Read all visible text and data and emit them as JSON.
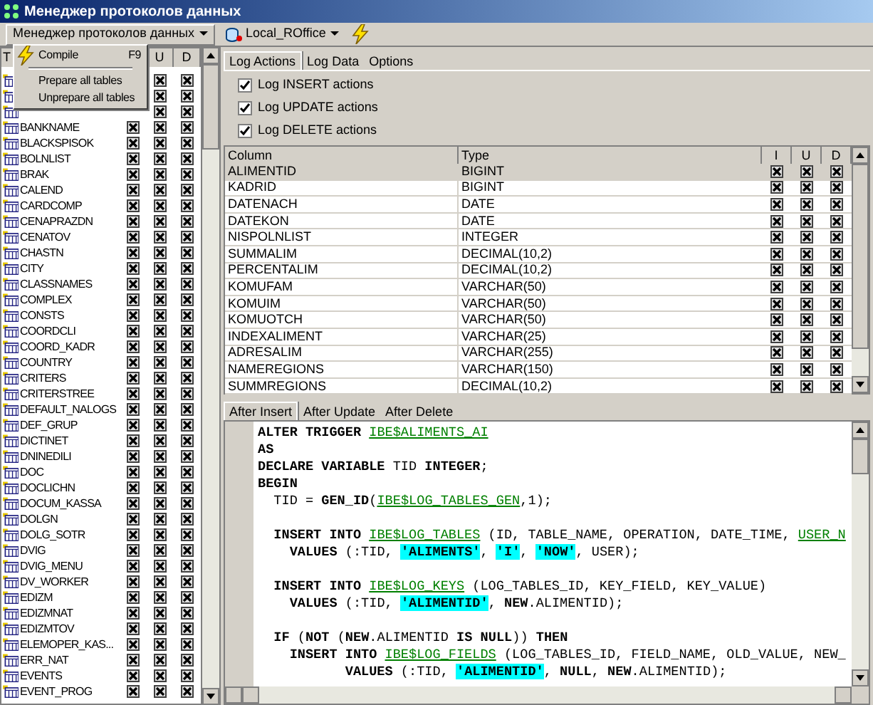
{
  "window": {
    "title": "Менеджер протоколов данных"
  },
  "toolbar": {
    "manager_button": "Менеджер протоколов данных",
    "database_button": "Local_ROffice"
  },
  "menu": {
    "items": [
      {
        "kind": "command",
        "label": "Compile",
        "shortcut": "F9"
      },
      {
        "kind": "separator"
      },
      {
        "kind": "command",
        "label": "Prepare all tables"
      },
      {
        "kind": "command",
        "label": "Unprepare all tables"
      }
    ]
  },
  "tables": {
    "columns": [
      "T",
      "U",
      "D"
    ],
    "rows": [
      {
        "u": true,
        "d": true
      },
      {
        "u": true,
        "d": true
      },
      {
        "u": true,
        "d": true
      },
      {
        "name": "BANKNAME",
        "i": true,
        "u": true,
        "d": true
      },
      {
        "name": "BLACKSPISOK",
        "i": true,
        "u": true,
        "d": true
      },
      {
        "name": "BOLNLIST",
        "i": true,
        "u": true,
        "d": true
      },
      {
        "name": "BRAK",
        "i": true,
        "u": true,
        "d": true
      },
      {
        "name": "CALEND",
        "i": true,
        "u": true,
        "d": true
      },
      {
        "name": "CARDCOMP",
        "i": true,
        "u": true,
        "d": true
      },
      {
        "name": "CENAPRAZDN",
        "i": true,
        "u": true,
        "d": true
      },
      {
        "name": "CENATOV",
        "i": true,
        "u": true,
        "d": true
      },
      {
        "name": "CHASTN",
        "i": true,
        "u": true,
        "d": true
      },
      {
        "name": "CITY",
        "i": true,
        "u": true,
        "d": true
      },
      {
        "name": "CLASSNAMES",
        "i": true,
        "u": true,
        "d": true
      },
      {
        "name": "COMPLEX",
        "i": true,
        "u": true,
        "d": true
      },
      {
        "name": "CONSTS",
        "i": true,
        "u": true,
        "d": true
      },
      {
        "name": "COORDCLI",
        "i": true,
        "u": true,
        "d": true
      },
      {
        "name": "COORD_KADR",
        "i": true,
        "u": true,
        "d": true
      },
      {
        "name": "COUNTRY",
        "i": true,
        "u": true,
        "d": true
      },
      {
        "name": "CRITERS",
        "i": true,
        "u": true,
        "d": true
      },
      {
        "name": "CRITERSTREE",
        "i": true,
        "u": true,
        "d": true
      },
      {
        "name": "DEFAULT_NALOGS",
        "i": true,
        "u": true,
        "d": true
      },
      {
        "name": "DEF_GRUP",
        "i": true,
        "u": true,
        "d": true
      },
      {
        "name": "DICTINET",
        "i": true,
        "u": true,
        "d": true
      },
      {
        "name": "DNINEDILI",
        "i": true,
        "u": true,
        "d": true
      },
      {
        "name": "DOC",
        "i": true,
        "u": true,
        "d": true
      },
      {
        "name": "DOCLICHN",
        "i": true,
        "u": true,
        "d": true
      },
      {
        "name": "DOCUM_KASSA",
        "i": true,
        "u": true,
        "d": true
      },
      {
        "name": "DOLGN",
        "i": true,
        "u": true,
        "d": true
      },
      {
        "name": "DOLG_SOTR",
        "i": true,
        "u": true,
        "d": true
      },
      {
        "name": "DVIG",
        "i": true,
        "u": true,
        "d": true
      },
      {
        "name": "DVIG_MENU",
        "i": true,
        "u": true,
        "d": true
      },
      {
        "name": "DV_WORKER",
        "i": true,
        "u": true,
        "d": true
      },
      {
        "name": "EDIZM",
        "i": true,
        "u": true,
        "d": true
      },
      {
        "name": "EDIZMNAT",
        "i": true,
        "u": true,
        "d": true
      },
      {
        "name": "EDIZMTOV",
        "i": true,
        "u": true,
        "d": true
      },
      {
        "name": "ELEMOPER_KAS...",
        "i": true,
        "u": true,
        "d": true
      },
      {
        "name": "ERR_NAT",
        "i": true,
        "u": true,
        "d": true
      },
      {
        "name": "EVENTS",
        "i": true,
        "u": true,
        "d": true
      },
      {
        "name": "EVENT_PROG",
        "i": true,
        "u": true,
        "d": true
      }
    ]
  },
  "tabs": [
    {
      "label": "Log Actions",
      "selected": true
    },
    {
      "label": "Log Data",
      "selected": false
    },
    {
      "label": "Options",
      "selected": false
    }
  ],
  "options": [
    {
      "label": "Log INSERT actions",
      "checked": true
    },
    {
      "label": "Log UPDATE actions",
      "checked": true
    },
    {
      "label": "Log DELETE actions",
      "checked": true
    }
  ],
  "fields": {
    "columns": [
      "Column",
      "Type",
      "I",
      "U",
      "D"
    ],
    "rows": [
      {
        "column": "ALIMENTID",
        "type": "BIGINT",
        "i": true,
        "u": true,
        "d": true,
        "selected": true
      },
      {
        "column": "KADRID",
        "type": "BIGINT",
        "i": true,
        "u": true,
        "d": true,
        "selected": false
      },
      {
        "column": "DATENACH",
        "type": "DATE",
        "i": true,
        "u": true,
        "d": true,
        "selected": false
      },
      {
        "column": "DATEKON",
        "type": "DATE",
        "i": true,
        "u": true,
        "d": true,
        "selected": false
      },
      {
        "column": "NISPOLNLIST",
        "type": "INTEGER",
        "i": true,
        "u": true,
        "d": true,
        "selected": false
      },
      {
        "column": "SUMMALIM",
        "type": "DECIMAL(10,2)",
        "i": true,
        "u": true,
        "d": true,
        "selected": false
      },
      {
        "column": "PERCENTALIM",
        "type": "DECIMAL(10,2)",
        "i": true,
        "u": true,
        "d": true,
        "selected": false
      },
      {
        "column": "KOMUFAM",
        "type": "VARCHAR(50)",
        "i": true,
        "u": true,
        "d": true,
        "selected": false
      },
      {
        "column": "KOMUIM",
        "type": "VARCHAR(50)",
        "i": true,
        "u": true,
        "d": true,
        "selected": false
      },
      {
        "column": "KOMUOTCH",
        "type": "VARCHAR(50)",
        "i": true,
        "u": true,
        "d": true,
        "selected": false
      },
      {
        "column": "INDEXALIMENT",
        "type": "VARCHAR(25)",
        "i": true,
        "u": true,
        "d": true,
        "selected": false
      },
      {
        "column": "ADRESALIM",
        "type": "VARCHAR(255)",
        "i": true,
        "u": true,
        "d": true,
        "selected": false
      },
      {
        "column": "NAMEREGIONS",
        "type": "VARCHAR(150)",
        "i": true,
        "u": true,
        "d": true,
        "selected": false
      },
      {
        "column": "SUMMREGIONS",
        "type": "DECIMAL(10,2)",
        "i": true,
        "u": true,
        "d": true,
        "selected": false
      }
    ]
  },
  "trigger_tabs": [
    {
      "label": "After Insert",
      "selected": true
    },
    {
      "label": "After Update",
      "selected": false
    },
    {
      "label": "After Delete",
      "selected": false
    }
  ],
  "code": [
    {
      "kind": "code",
      "segments": [
        {
          "kind": "kw",
          "text": "ALTER TRIGGER "
        },
        {
          "kind": "id",
          "text": "IBE$ALIMENTS_AI"
        }
      ]
    },
    {
      "kind": "code",
      "segments": [
        {
          "kind": "kw",
          "text": "AS"
        }
      ]
    },
    {
      "kind": "code",
      "segments": [
        {
          "kind": "kw",
          "text": "DECLARE VARIABLE"
        },
        {
          "kind": "plain",
          "text": " TID "
        },
        {
          "kind": "kw",
          "text": "INTEGER"
        },
        {
          "kind": "plain",
          "text": ";"
        }
      ]
    },
    {
      "kind": "code",
      "segments": [
        {
          "kind": "kw",
          "text": "BEGIN"
        }
      ]
    },
    {
      "kind": "code",
      "segments": [
        {
          "kind": "plain",
          "text": "  TID = "
        },
        {
          "kind": "kw",
          "text": "GEN_ID"
        },
        {
          "kind": "plain",
          "text": "("
        },
        {
          "kind": "id",
          "text": "IBE$LOG_TABLES_GEN"
        },
        {
          "kind": "plain",
          "text": ",1);"
        }
      ]
    },
    {
      "kind": "blank"
    },
    {
      "kind": "code",
      "segments": [
        {
          "kind": "kw",
          "text": "  INSERT INTO "
        },
        {
          "kind": "id",
          "text": "IBE$LOG_TABLES"
        },
        {
          "kind": "plain",
          "text": " (ID, TABLE_NAME, OPERATION, DATE_TIME, "
        },
        {
          "kind": "id",
          "text": "USER_N"
        }
      ]
    },
    {
      "kind": "code",
      "segments": [
        {
          "kind": "kw",
          "text": "    VALUES"
        },
        {
          "kind": "plain",
          "text": " (:TID, "
        },
        {
          "kind": "str",
          "text": "'ALIMENTS'"
        },
        {
          "kind": "plain",
          "text": ", "
        },
        {
          "kind": "str",
          "text": "'I'"
        },
        {
          "kind": "plain",
          "text": ", "
        },
        {
          "kind": "str",
          "text": "'NOW'"
        },
        {
          "kind": "plain",
          "text": ", USER);"
        }
      ]
    },
    {
      "kind": "blank"
    },
    {
      "kind": "code",
      "segments": [
        {
          "kind": "kw",
          "text": "  INSERT INTO "
        },
        {
          "kind": "id",
          "text": "IBE$LOG_KEYS"
        },
        {
          "kind": "plain",
          "text": " (LOG_TABLES_ID, KEY_FIELD, KEY_VALUE)"
        }
      ]
    },
    {
      "kind": "code",
      "segments": [
        {
          "kind": "kw",
          "text": "    VALUES"
        },
        {
          "kind": "plain",
          "text": " (:TID, "
        },
        {
          "kind": "str",
          "text": "'ALIMENTID'"
        },
        {
          "kind": "plain",
          "text": ", "
        },
        {
          "kind": "kw",
          "text": "NEW"
        },
        {
          "kind": "plain",
          "text": ".ALIMENTID);"
        }
      ]
    },
    {
      "kind": "blank"
    },
    {
      "kind": "code",
      "segments": [
        {
          "kind": "kw",
          "text": "  IF"
        },
        {
          "kind": "plain",
          "text": " ("
        },
        {
          "kind": "kw",
          "text": "NOT"
        },
        {
          "kind": "plain",
          "text": " ("
        },
        {
          "kind": "kw",
          "text": "NEW"
        },
        {
          "kind": "plain",
          "text": ".ALIMENTID "
        },
        {
          "kind": "kw",
          "text": "IS NULL"
        },
        {
          "kind": "plain",
          "text": ")) "
        },
        {
          "kind": "kw",
          "text": "THEN"
        }
      ]
    },
    {
      "kind": "code",
      "segments": [
        {
          "kind": "kw",
          "text": "    INSERT INTO "
        },
        {
          "kind": "id",
          "text": "IBE$LOG_FIELDS"
        },
        {
          "kind": "plain",
          "text": " (LOG_TABLES_ID, FIELD_NAME, OLD_VALUE, NEW_"
        }
      ]
    },
    {
      "kind": "code",
      "segments": [
        {
          "kind": "kw",
          "text": "           VALUES"
        },
        {
          "kind": "plain",
          "text": " (:TID, "
        },
        {
          "kind": "str",
          "text": "'ALIMENTID'"
        },
        {
          "kind": "plain",
          "text": ", "
        },
        {
          "kind": "kw",
          "text": "NULL"
        },
        {
          "kind": "plain",
          "text": ", "
        },
        {
          "kind": "kw",
          "text": "NEW"
        },
        {
          "kind": "plain",
          "text": ".ALIMENTID);"
        }
      ]
    }
  ]
}
